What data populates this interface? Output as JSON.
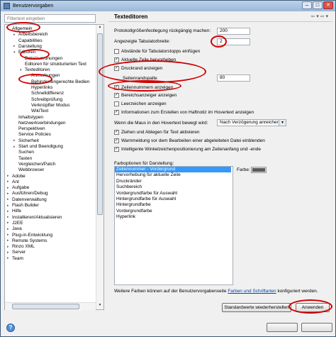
{
  "window": {
    "title": "Benutzervorgaben",
    "minimize": "–",
    "maximize": "□",
    "close": "✕"
  },
  "filter": {
    "placeholder": "Filtertext eingeben"
  },
  "tree": [
    {
      "label": "Allgemein",
      "level": 0,
      "toggle": "▾"
    },
    {
      "label": "Arbeitsbereich",
      "level": 1,
      "toggle": "▸"
    },
    {
      "label": "Capabilities",
      "level": 1,
      "toggle": ""
    },
    {
      "label": "Darstellung",
      "level": 1,
      "toggle": "▸"
    },
    {
      "label": "Editoren",
      "level": 1,
      "toggle": "▾"
    },
    {
      "label": "Dateizuordnungen",
      "level": 2,
      "toggle": ""
    },
    {
      "label": "Editoren für strukturierten Text",
      "level": 2,
      "toggle": ""
    },
    {
      "label": "Texteditoren",
      "level": 2,
      "toggle": "▾"
    },
    {
      "label": "Anmerkungen",
      "level": 3,
      "toggle": ""
    },
    {
      "label": "Behindertengerechte Bedien",
      "level": 3,
      "toggle": ""
    },
    {
      "label": "Hyperlinks",
      "level": 3,
      "toggle": ""
    },
    {
      "label": "Schnelldifferenz",
      "level": 3,
      "toggle": ""
    },
    {
      "label": "Schreibprüfung",
      "level": 3,
      "toggle": ""
    },
    {
      "label": "Verknüpfter Modus",
      "level": 3,
      "toggle": ""
    },
    {
      "label": "WikiText",
      "level": 3,
      "toggle": ""
    },
    {
      "label": "Inhaltstypen",
      "level": 1,
      "toggle": ""
    },
    {
      "label": "Netzwerkverbindungen",
      "level": 1,
      "toggle": ""
    },
    {
      "label": "Perspektiven",
      "level": 1,
      "toggle": ""
    },
    {
      "label": "Service Policies",
      "level": 1,
      "toggle": ""
    },
    {
      "label": "Sicherheit",
      "level": 1,
      "toggle": "▸"
    },
    {
      "label": "Start und Beendigung",
      "level": 1,
      "toggle": "▸"
    },
    {
      "label": "Suchen",
      "level": 1,
      "toggle": ""
    },
    {
      "label": "Tasten",
      "level": 1,
      "toggle": ""
    },
    {
      "label": "Vergleichen/Patch",
      "level": 1,
      "toggle": ""
    },
    {
      "label": "Webbrowser",
      "level": 1,
      "toggle": ""
    },
    {
      "label": "Adobe",
      "level": 0,
      "toggle": "▸"
    },
    {
      "label": "Ant",
      "level": 0,
      "toggle": "▸"
    },
    {
      "label": "Aufgabe",
      "level": 0,
      "toggle": "▸"
    },
    {
      "label": "Ausführen/Debug",
      "level": 0,
      "toggle": "▸"
    },
    {
      "label": "Datenverwaltung",
      "level": 0,
      "toggle": "▸"
    },
    {
      "label": "Flash Builder",
      "level": 0,
      "toggle": "▸"
    },
    {
      "label": "Hilfe",
      "level": 0,
      "toggle": "▸"
    },
    {
      "label": "Installieren/Aktualisieren",
      "level": 0,
      "toggle": "▸"
    },
    {
      "label": "J2EE",
      "level": 0,
      "toggle": "▸"
    },
    {
      "label": "Java",
      "level": 0,
      "toggle": "▸"
    },
    {
      "label": "Plug-in-Entwicklung",
      "level": 0,
      "toggle": "▸"
    },
    {
      "label": "Remote Systems",
      "level": 0,
      "toggle": "▸"
    },
    {
      "label": "Rinzo XML",
      "level": 0,
      "toggle": "▸"
    },
    {
      "label": "Server",
      "level": 0,
      "toggle": "▸"
    },
    {
      "label": "Team",
      "level": 0,
      "toggle": "▸"
    }
  ],
  "page": {
    "title": "Texteditoren",
    "nav_back": "⇦ ▾",
    "nav_fwd": "⇨ ▾",
    "undo_label": "Protokollgrößenfestlegung rückgängig machen:",
    "undo_value": "200",
    "tab_label": "Angezeigte Tabulatorbreite:",
    "tab_value": "2",
    "cb_spaces": "Abstände für Tabulatorstopps einfügen",
    "cb_current_line": "Aktuelle Zeile hervorheben",
    "cb_print_margin": "Druckrand anzeigen",
    "margin_label": "Seitenrandspalte",
    "margin_value": "80",
    "cb_line_numbers": "Zeilennummern anzeigen",
    "cb_range": "Bereichsanzeiger anzeigen",
    "cb_whitespace": "Leerzeichen anzeigen",
    "cb_hover_info": "Informationen zum Erstellen von Haftnotiz im Hovertext anzeigen",
    "hover_label": "Wenn die Maus in den Hovertext bewegt wird:",
    "hover_value": "Nach Verzögerung anreichern",
    "cb_drag_drop": "Ziehen und Ablegen für Text aktivieren",
    "cb_warn_derived": "Warnmeldung vor dem Bearbeiten einer abgeleiteten Datei einblenden",
    "cb_smart_caret": "Intelligente Winkelzeichenpositionierung am Zeilenanfang und -ende",
    "color_options_label": "Farboptionen für Darstellung:",
    "color_options": [
      "Zeilennummer - Vordergrund",
      "Hervorhebung für aktuelle Zeile",
      "Druckränder",
      "Suchbereich",
      "Vordergrundfarbe für Auswahl",
      "Hintergrundfarbe für Auswahl",
      "Hintergrundfarbe",
      "Vordergrundfarbe",
      "Hyperlink"
    ],
    "color_label": "Farbe:",
    "footer_text_pre": "Weitere Farben können auf der Benutzervorgabenseite",
    "footer_link": "Farben und Schriftarten",
    "footer_text_post": "konfiguriert werden.",
    "restore_button": "Standardwerte wiederherstellen",
    "apply_button": "Anwenden",
    "checks": {
      "spaces": "",
      "current_line": "✓",
      "print_margin": "✓",
      "line_numbers": "✓",
      "range": "✓",
      "whitespace": "",
      "hover_info": "✓",
      "drag_drop": "✓",
      "warn_derived": "✓",
      "smart_caret": "✓"
    }
  },
  "bottom": {
    "help_icon": "?"
  },
  "colors": {
    "annotation": "#d10000",
    "selection": "#3399ff",
    "swatch": "#5a5a5a"
  }
}
